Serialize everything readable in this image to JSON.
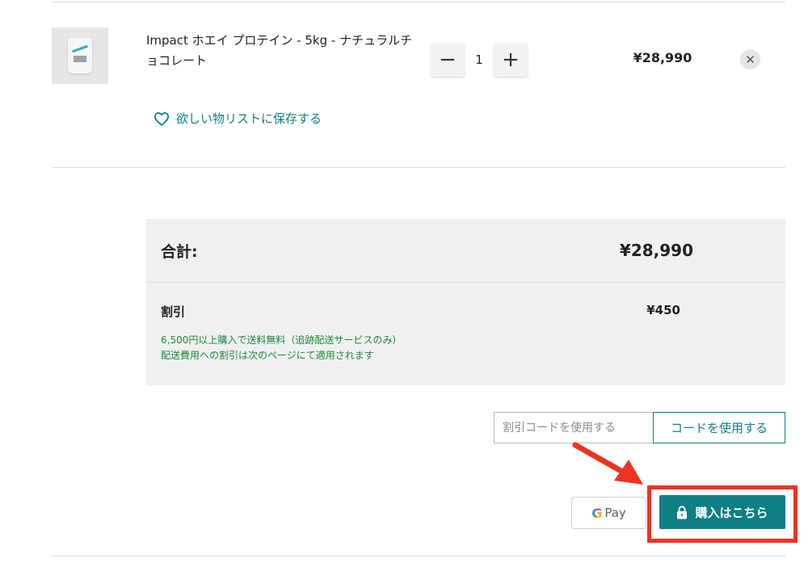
{
  "cart_item": {
    "name": "Impact ホエイ プロテイン - 5kg - ナチュラルチョコレート",
    "quantity": "1",
    "decrement_symbol": "−",
    "increment_symbol": "+",
    "price": "¥28,990",
    "remove_symbol": "✕",
    "image_icon": "whey-protein-bag-icon"
  },
  "wishlist": {
    "label": "欲しい物リストに保存する",
    "icon": "heart-icon"
  },
  "totals": {
    "total_label": "合計:",
    "total_value": "¥28,990",
    "discount_label": "割引",
    "discount_value": "¥450",
    "note_line1": "6,500円以上購入で送料無料（追跡配送サービスのみ）",
    "note_line2": "配送費用への割引は次のページにて適用されます"
  },
  "promo": {
    "placeholder": "割引コードを使用する",
    "button_label": "コードを使用する"
  },
  "payment": {
    "gpay_g": "G",
    "gpay_label": "Pay",
    "checkout_label": "購入はこちら",
    "checkout_icon": "lock-icon"
  },
  "colors": {
    "accent": "#0e7f84",
    "discount_note": "#1a8a36",
    "annotation": "#ee3322"
  }
}
